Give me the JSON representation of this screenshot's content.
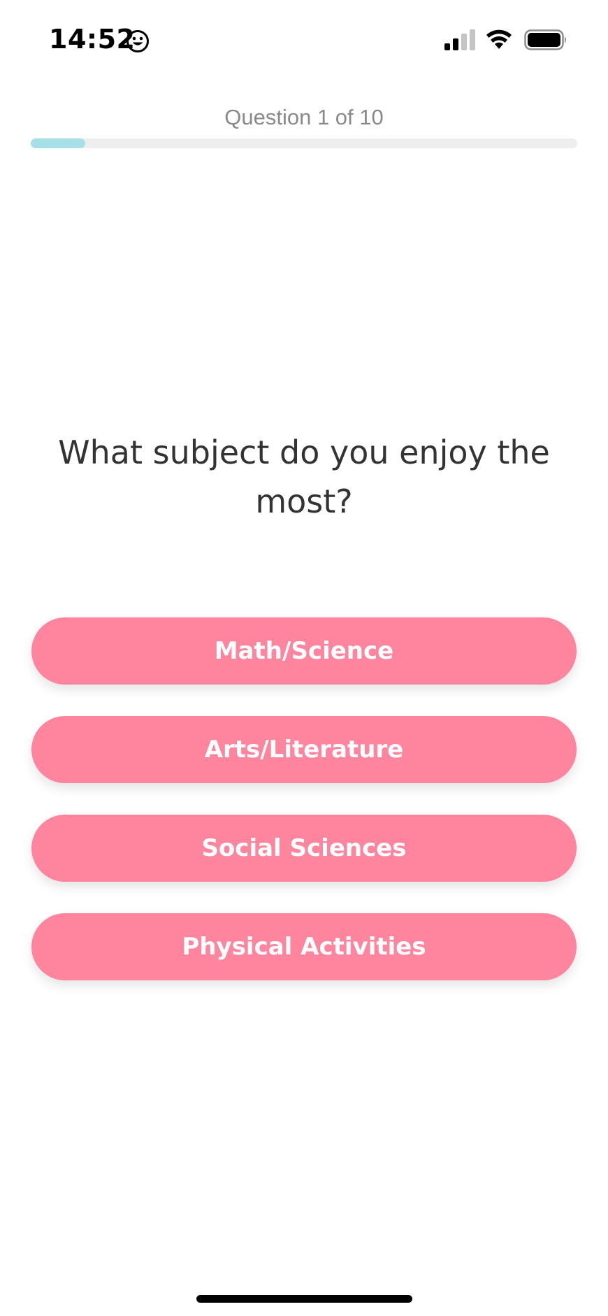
{
  "status_bar": {
    "time": "14:52",
    "icons": [
      "smiley-icon",
      "cellular-signal-icon",
      "wifi-icon",
      "battery-icon"
    ]
  },
  "progress": {
    "label": "Question 1 of 10",
    "current": 1,
    "total": 10,
    "fill_fraction": 0.1,
    "fill_color": "#a6e0e6",
    "track_color": "#eeeeee"
  },
  "question": {
    "text": "What subject do you enjoy the most?"
  },
  "answers": [
    {
      "label": "Math/Science"
    },
    {
      "label": "Arts/Literature"
    },
    {
      "label": "Social Sciences"
    },
    {
      "label": "Physical Activities"
    }
  ],
  "colors": {
    "button": "#ff859f",
    "button_text": "#ffffff",
    "question_text": "#333333",
    "label_text": "#8a8a8a"
  }
}
